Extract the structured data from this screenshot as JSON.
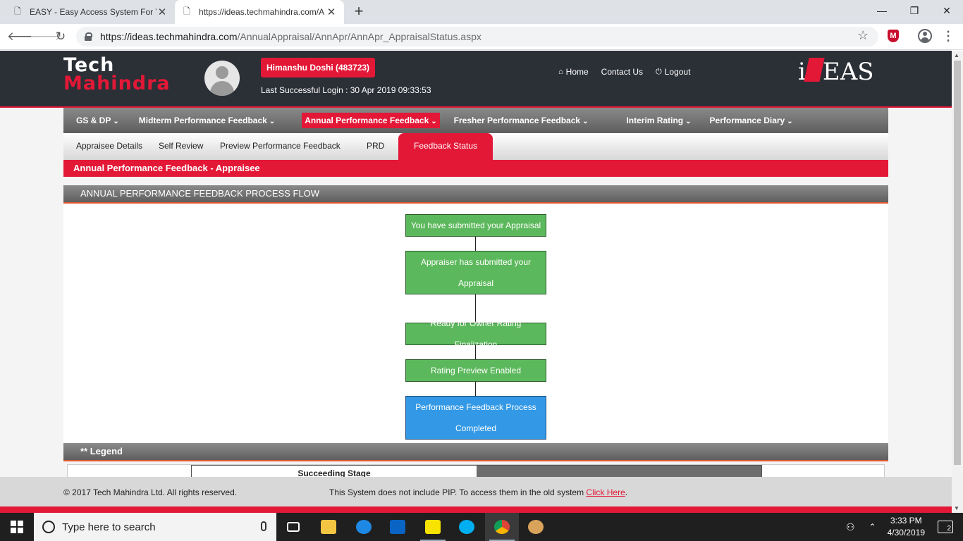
{
  "browser": {
    "tabs": [
      {
        "title": "EASY - Easy Access System For Yo"
      },
      {
        "title": "https://ideas.techmahindra.com/A"
      }
    ],
    "url_host": "https://ideas.techmahindra.com",
    "url_path": "/AnnualAppraisal/AnnApr/AnnApr_AppraisalStatus.aspx",
    "new_tab": "+",
    "close": "✕",
    "minimize": "—",
    "restore": "❐",
    "mcafee_letter": "M"
  },
  "header": {
    "logo_line1": "Tech",
    "logo_line2": "Mahindra",
    "user_name": "Himanshu Doshi (483723)",
    "last_login": "Last Successful Login : 30 Apr 2019 09:33:53",
    "links": {
      "home": "Home",
      "contact": "Contact Us",
      "logout": "Logout"
    },
    "brand_i": "i",
    "brand_rest": "EAS"
  },
  "main_nav": [
    {
      "label": "GS & DP"
    },
    {
      "label": "Midterm Performance Feedback"
    },
    {
      "label": "Annual Performance Feedback",
      "active": true
    },
    {
      "label": "Fresher Performance Feedback"
    },
    {
      "label": "Interim Rating"
    },
    {
      "label": "Performance Diary"
    }
  ],
  "sub_nav": [
    {
      "label": "Appraisee Details"
    },
    {
      "label": "Self Review"
    },
    {
      "label": "Preview Performance Feedback"
    },
    {
      "label": "PRD"
    },
    {
      "label": "Feedback Status",
      "active": true
    }
  ],
  "page_title": "Annual Performance Feedback - Appraisee",
  "process_flow": {
    "heading": "ANNUAL PERFORMANCE FEEDBACK PROCESS FLOW",
    "steps": [
      {
        "label": "You have submitted your Appraisal",
        "status": "done"
      },
      {
        "label": "Appraiser has submitted your Appraisal",
        "status": "done"
      },
      {
        "label": "Ready for Owner Rating Finalization",
        "status": "done"
      },
      {
        "label": "Rating Preview Enabled",
        "status": "done"
      },
      {
        "label": "Performance Feedback Process Completed",
        "status": "current"
      }
    ]
  },
  "legend": {
    "heading": "** Legend",
    "succeeding_stage": "Succeeding Stage"
  },
  "footer": {
    "copyright": "© 2017 Tech Mahindra Ltd. All rights reserved.",
    "pip_note": "This System does not include PIP. To access them in the old system",
    "click_here": "Click Here",
    "period": "."
  },
  "taskbar": {
    "search_placeholder": "Type here to search",
    "time": "3:33 PM",
    "date": "4/30/2019",
    "notifications": "2"
  },
  "colors": {
    "brand_red": "#e31837",
    "header_dark": "#2b2f36",
    "step_done": "#5cb85c",
    "step_current": "#3399e6"
  }
}
